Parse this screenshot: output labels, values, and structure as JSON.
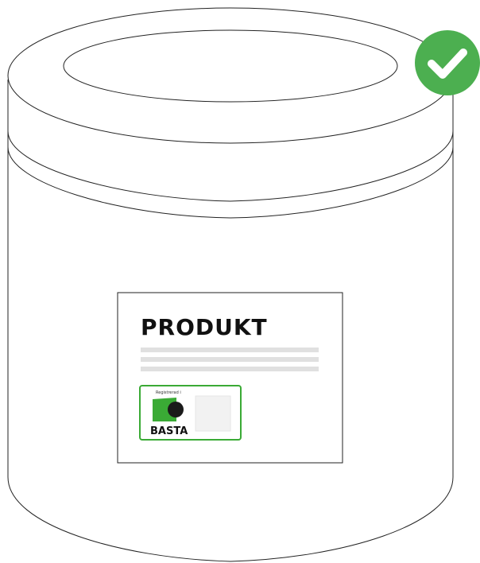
{
  "label": {
    "title": "PRODUKT",
    "badge_caption": "Registrerad i",
    "badge_brand": "BASTA"
  },
  "check_badge": {
    "icon": "checkmark-icon",
    "color": "#4caf50"
  },
  "colors": {
    "basta_green": "#3aaa35",
    "basta_border": "#3aaa35",
    "text_line": "#e0e0e0",
    "title": "#111111"
  }
}
